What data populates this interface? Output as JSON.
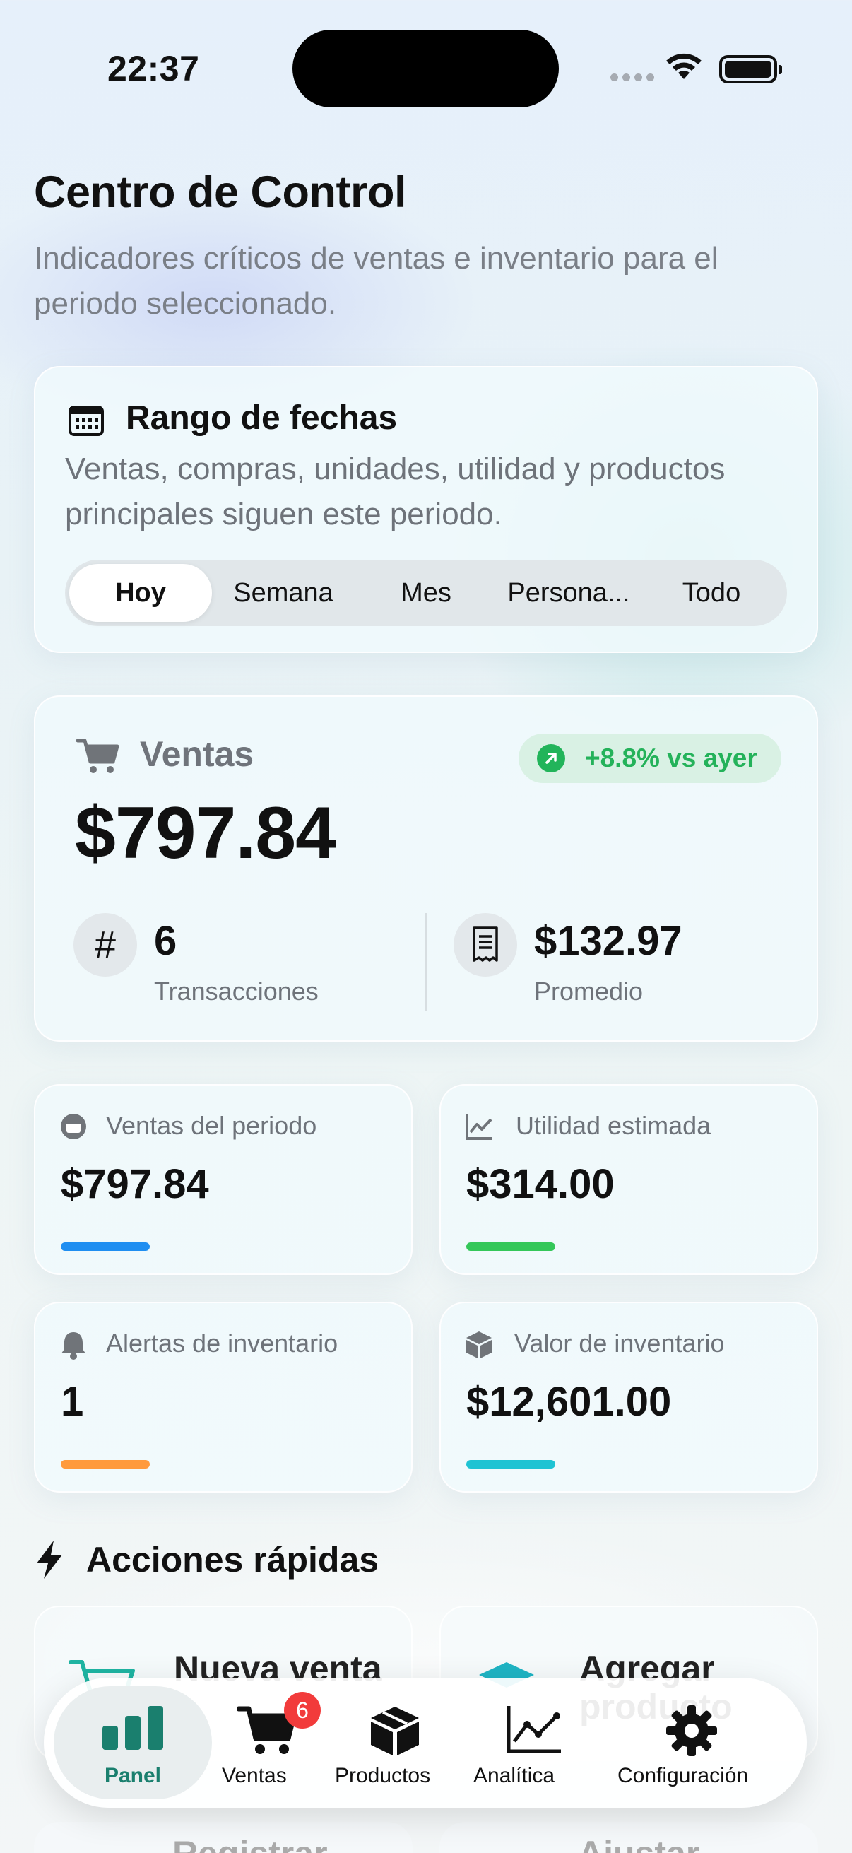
{
  "status_bar": {
    "time": "22:37"
  },
  "header": {
    "title": "Centro de Control",
    "subtitle": "Indicadores críticos de ventas e inventario para el periodo seleccionado."
  },
  "date_range": {
    "title": "Rango de fechas",
    "description": "Ventas, compras, unidades, utilidad y productos principales siguen este periodo.",
    "options": [
      "Hoy",
      "Semana",
      "Mes",
      "Persona...",
      "Todo"
    ],
    "selected": "Hoy"
  },
  "sales": {
    "label": "Ventas",
    "trend": "+8.8% vs ayer",
    "amount": "$797.84",
    "transactions_value": "6",
    "transactions_label": "Transacciones",
    "average_value": "$132.97",
    "average_label": "Promedio"
  },
  "stats": [
    {
      "label": "Ventas del periodo",
      "value": "$797.84",
      "color": "#1f8ef1"
    },
    {
      "label": "Utilidad estimada",
      "value": "$314.00",
      "color": "#34c759"
    },
    {
      "label": "Alertas de inventario",
      "value": "1",
      "color": "#ff9a3c"
    },
    {
      "label": "Valor de inventario",
      "value": "$12,601.00",
      "color": "#1fc3d3"
    }
  ],
  "quick_actions": {
    "title": "Acciones rápidas",
    "items": [
      {
        "label": "Nueva venta"
      },
      {
        "label": "Agregar producto"
      },
      {
        "label": "Registrar"
      },
      {
        "label": "Ajustar"
      }
    ]
  },
  "tabbar": {
    "tabs": [
      {
        "label": "Panel",
        "icon": "bar-chart-icon"
      },
      {
        "label": "Ventas",
        "icon": "cart-icon",
        "badge": "6"
      },
      {
        "label": "Productos",
        "icon": "box-icon"
      },
      {
        "label": "Analítica",
        "icon": "line-chart-icon"
      },
      {
        "label": "Configuración",
        "icon": "gear-icon"
      }
    ],
    "active": "Panel",
    "accent": "#1a7f6e"
  }
}
